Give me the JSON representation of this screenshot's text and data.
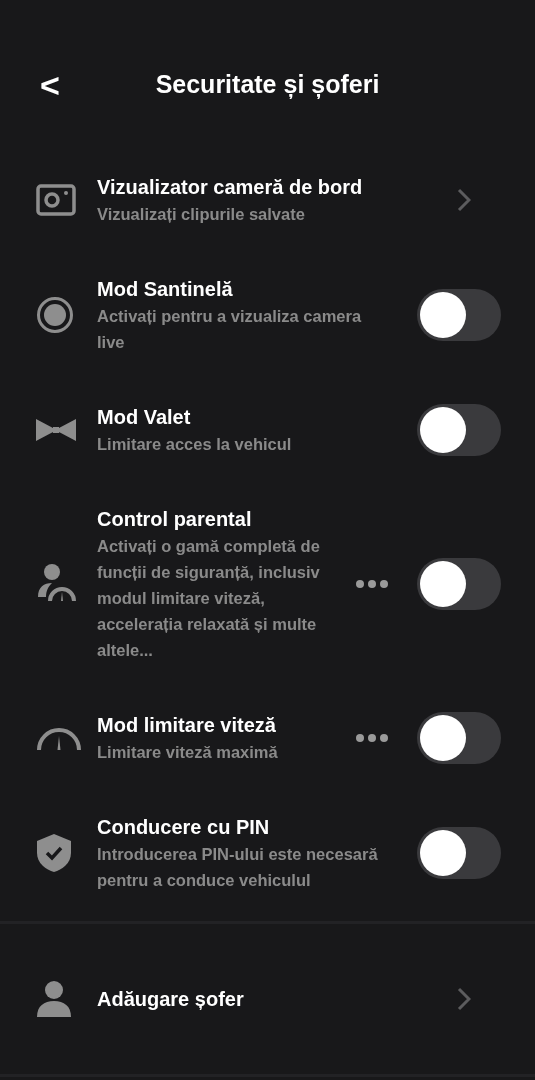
{
  "header": {
    "back": "<",
    "title": "Securitate și șoferi"
  },
  "rows": [
    {
      "kind": "link",
      "title": "Vizualizator cameră de bord",
      "subtitle": "Vizualizați clipurile salvate"
    },
    {
      "kind": "toggle",
      "title": "Mod Santinelă",
      "subtitle": "Activați pentru a vizualiza camera live",
      "on": false,
      "more": false
    },
    {
      "kind": "toggle",
      "title": "Mod Valet",
      "subtitle": "Limitare acces la vehicul",
      "on": false,
      "more": false
    },
    {
      "kind": "toggle",
      "title": "Control parental",
      "subtitle": "Activați o gamă completă de funcții de siguranță, inclusiv modul limitare viteză, accelerația relaxată și multe altele...",
      "on": false,
      "more": true
    },
    {
      "kind": "toggle",
      "title": "Mod limitare viteză",
      "subtitle": "Limitare viteză maximă",
      "on": false,
      "more": true
    },
    {
      "kind": "toggle",
      "title": "Conducere cu PIN",
      "subtitle": "Introducerea PIN-ului este necesară pentru a conduce vehiculul",
      "on": false,
      "more": false
    }
  ],
  "drivers": {
    "title": "Adăugare șofer"
  }
}
